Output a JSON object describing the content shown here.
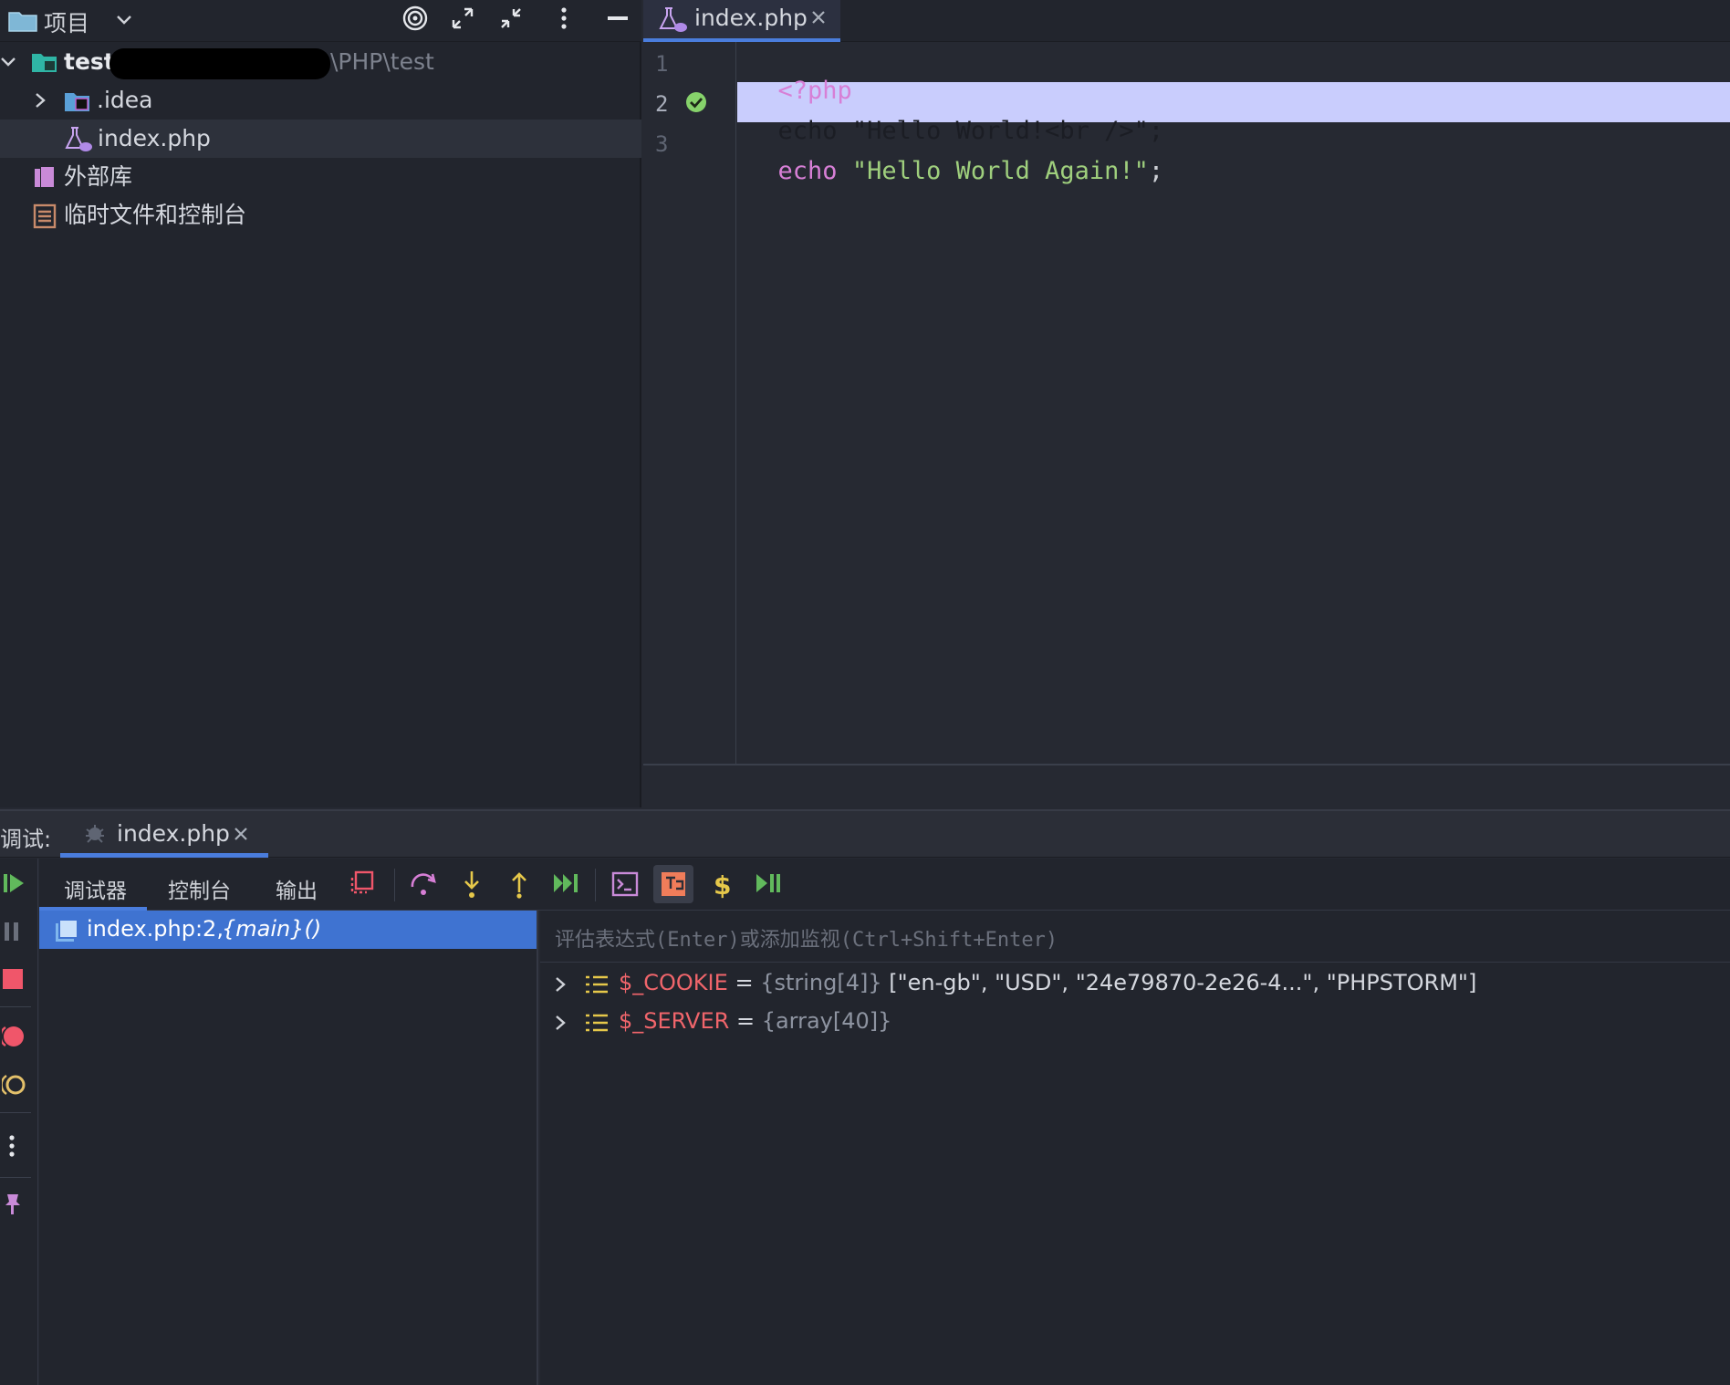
{
  "project_panel": {
    "title": "项目",
    "tree": [
      {
        "label": "test",
        "path": "\\PHP\\test"
      },
      {
        "label": ".idea"
      },
      {
        "label": "index.php"
      },
      {
        "label": "外部库"
      },
      {
        "label": "临时文件和控制台"
      }
    ]
  },
  "editor": {
    "tab_label": "index.php",
    "lines": [
      {
        "num": "1",
        "parts": [
          "<?php"
        ]
      },
      {
        "num": "2",
        "parts": [
          "echo",
          " ",
          "\"Hello World!<br />\"",
          ";"
        ]
      },
      {
        "num": "3",
        "parts": [
          "echo",
          " ",
          "\"Hello World Again!\"",
          ";"
        ]
      }
    ]
  },
  "debug": {
    "prefix": "调试:",
    "session_tab": "index.php",
    "tabs": [
      "调试器",
      "控制台",
      "输出"
    ],
    "frame": {
      "file": "index.php:2,",
      "func": "{main}()"
    },
    "eval_placeholder": "评估表达式(Enter)或添加监视(Ctrl+Shift+Enter)",
    "variables": [
      {
        "name": "$_COOKIE",
        "eq": "=",
        "type": "{string[4]}",
        "value": "[\"en-gb\", \"USD\", \"24e79870-2e26-4...\", \"PHPSTORM\"]"
      },
      {
        "name": "$_SERVER",
        "eq": "=",
        "type": "{array[40]}",
        "value": ""
      }
    ]
  },
  "colors": {
    "accent": "#4a7ddd",
    "highlight_line": "#c9cdfd",
    "keyword": "#d77fd6",
    "string": "#9fcf7d",
    "var_name": "#f0656b",
    "breakpoint_ok": "#86d26b"
  }
}
